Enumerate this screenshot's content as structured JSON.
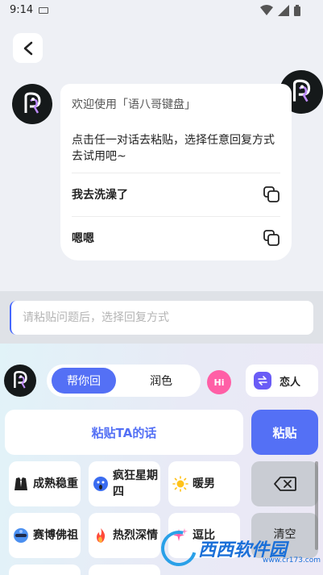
{
  "status": {
    "time": "9:14"
  },
  "chat": {
    "welcome": "欢迎使用「语八哥键盘」",
    "instruction": "点击任一对话去粘贴，选择任意回复方式去试用吧~",
    "replies": [
      "我去洗澡了",
      "嗯嗯"
    ]
  },
  "input": {
    "placeholder": "请粘贴问题后，选择回复方式"
  },
  "keyboard": {
    "modes": {
      "help": "帮你回",
      "polish": "润色"
    },
    "hi_label": "Hi",
    "role": "恋人",
    "paste_ta": "粘贴TA的话",
    "paste": "粘贴",
    "styles": [
      {
        "label": "成熟稳重",
        "icon": "suit-icon"
      },
      {
        "label": "疯狂星期四",
        "icon": "scream-icon"
      },
      {
        "label": "暖男",
        "icon": "sun-icon"
      },
      {
        "label": "赛博佛祖",
        "icon": "cyber-buddha-icon"
      },
      {
        "label": "热烈深情",
        "icon": "fire-icon"
      },
      {
        "label": "逗比",
        "icon": "sparkle-icon"
      }
    ],
    "clear": "清空"
  },
  "watermark": {
    "brand": "西西软件园",
    "url": "www.cr173.com"
  },
  "colors": {
    "accent": "#5470f5",
    "hi": "#ff5fa6",
    "role": "#6a5cf6"
  }
}
